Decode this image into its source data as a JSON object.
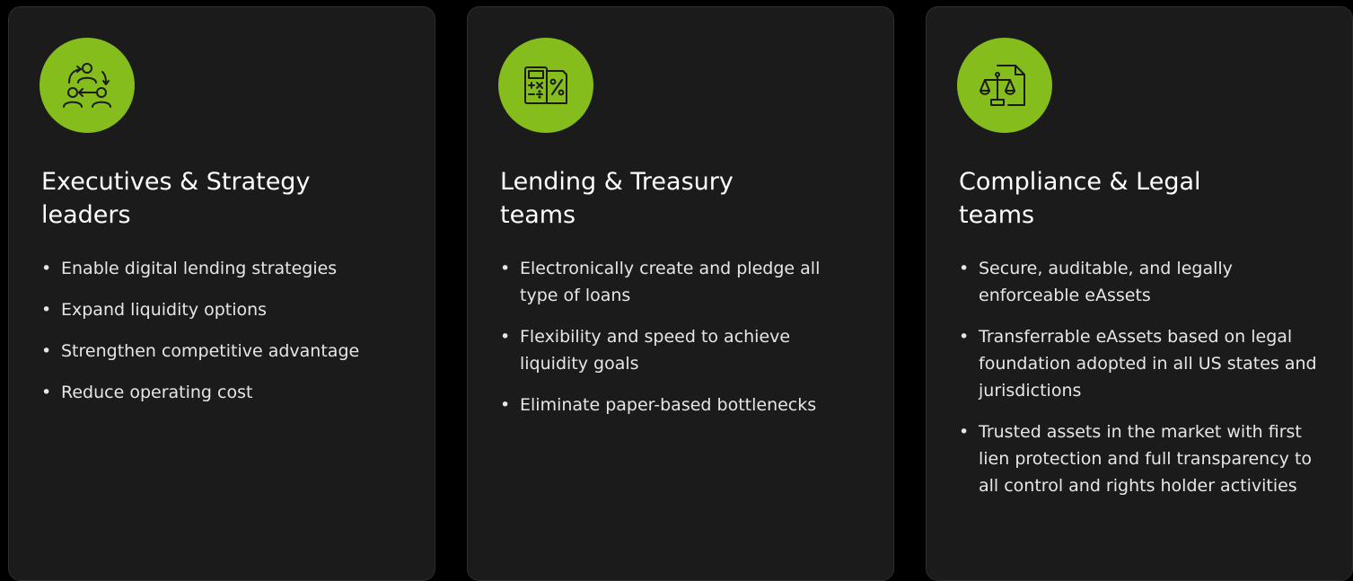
{
  "colors": {
    "background": "#000000",
    "card_background": "#1b1b1b",
    "card_border": "#2e2e2e",
    "accent_green": "#84bd1c",
    "text": "#ffffff"
  },
  "cards": [
    {
      "icon": "team-exchange-icon",
      "title_line1": "Executives & Strategy",
      "title_line2": "leaders",
      "bullets": [
        "Enable digital lending strategies",
        "Expand liquidity options",
        "Strengthen competitive advantage",
        "Reduce operating cost"
      ]
    },
    {
      "icon": "calculator-percent-icon",
      "title_line1": "Lending & Treasury",
      "title_line2": "teams",
      "bullets": [
        "Electronically create and pledge all type of loans",
        "Flexibility and speed to achieve liquidity goals",
        "Eliminate paper-based bottlenecks"
      ]
    },
    {
      "icon": "legal-scale-document-icon",
      "title_line1": "Compliance & Legal",
      "title_line2": "teams",
      "bullets": [
        "Secure, auditable, and legally enforceable eAssets",
        "Transferrable eAssets based on legal foundation adopted in all US states and jurisdictions",
        "Trusted assets in the market with first lien protection and full transparency to all control and rights holder activities"
      ]
    }
  ]
}
